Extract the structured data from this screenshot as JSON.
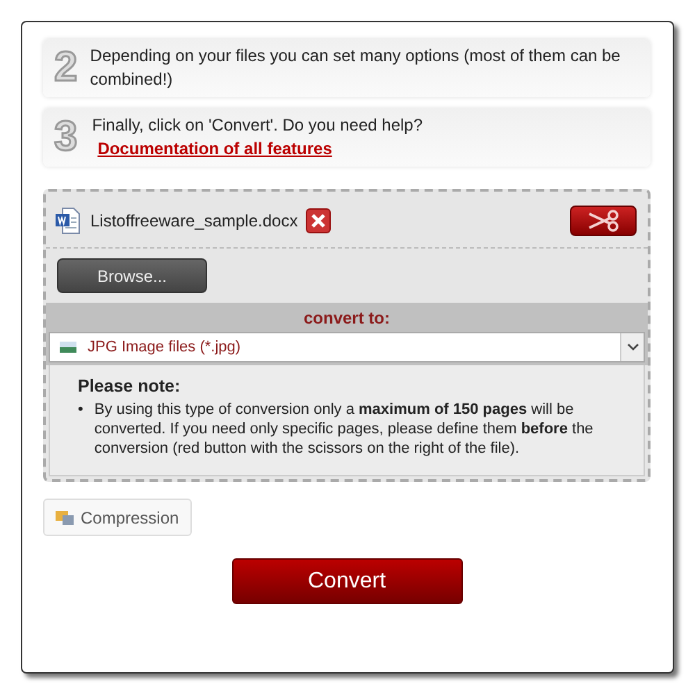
{
  "steps": [
    {
      "number": "2",
      "text": "Depending on your files you can set many options (most of them can be combined!)"
    },
    {
      "number": "3",
      "text": "Finally, click on 'Convert'. Do you need help?",
      "link": "Documentation of all features"
    }
  ],
  "file": {
    "name": "Listoffreeware_sample.docx"
  },
  "browse_button": "Browse...",
  "convert_to": {
    "label": "convert to:",
    "value": "JPG Image files (*.jpg)"
  },
  "note": {
    "title": "Please note:",
    "bullet": "•",
    "items": [
      "By using this type of conversion only a **maximum of 150 pages** will be converted. If you need only specific pages, please define them **before** the conversion (red button with the scissors on the right of the file)."
    ]
  },
  "compression_button": "Compression",
  "convert_button": "Convert"
}
